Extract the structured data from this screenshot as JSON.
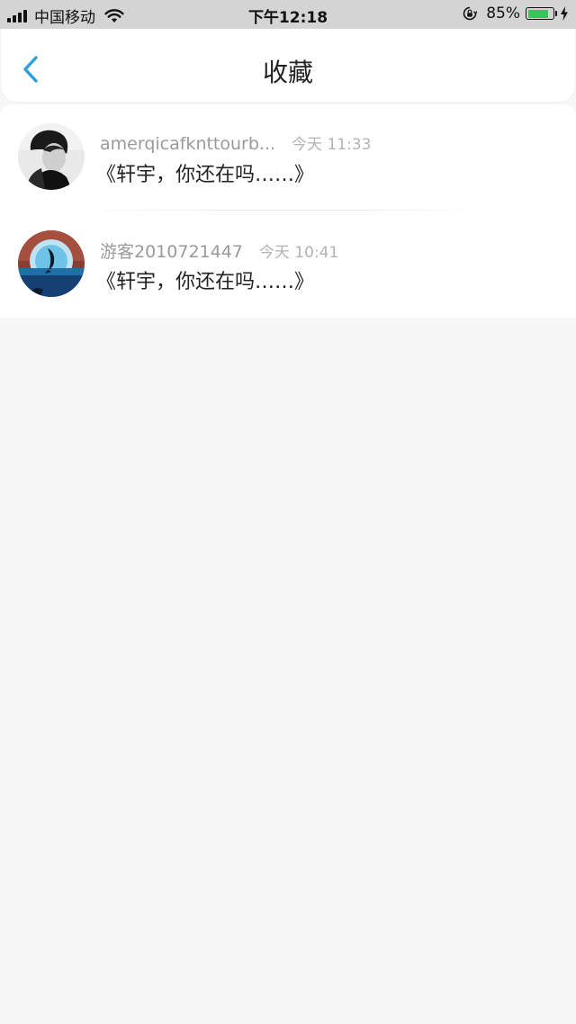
{
  "status_bar": {
    "carrier": "中国移动",
    "time": "下午12:18",
    "battery_percent": "85%",
    "battery_level": 0.85,
    "battery_color": "#34c759"
  },
  "nav": {
    "title": "收藏",
    "back_icon": "chevron-left-icon",
    "accent_color": "#2a9fe0"
  },
  "favorites": [
    {
      "avatar": "portrait-photo",
      "username": "amerqicafknttourb...",
      "time": "今天 11:33",
      "message": "《轩宇，你还在吗……》"
    },
    {
      "avatar": "dolphin-photo",
      "username": "游客2010721447",
      "time": "今天 10:41",
      "message": "《轩宇，你还在吗……》"
    }
  ]
}
